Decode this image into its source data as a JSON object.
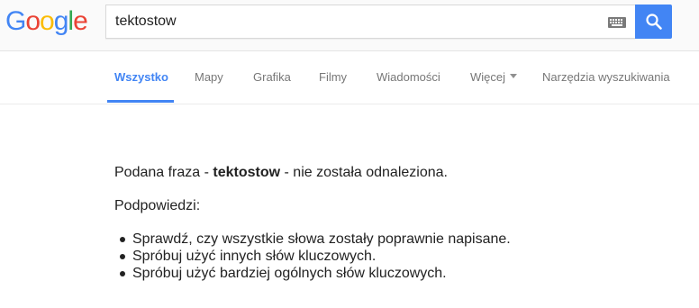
{
  "logo": {
    "letters": [
      {
        "char": "G",
        "color": "#4285f4"
      },
      {
        "char": "o",
        "color": "#ea4335"
      },
      {
        "char": "o",
        "color": "#fbbc05"
      },
      {
        "char": "g",
        "color": "#4285f4"
      },
      {
        "char": "l",
        "color": "#34a853"
      },
      {
        "char": "e",
        "color": "#ea4335"
      }
    ]
  },
  "search": {
    "query": "tektostow",
    "keyboard_icon": "keyboard-icon",
    "button_icon": "search-icon",
    "button_color": "#4285f4"
  },
  "tabs": [
    {
      "label": "Wszystko",
      "active": true
    },
    {
      "label": "Mapy",
      "active": false
    },
    {
      "label": "Grafika",
      "active": false
    },
    {
      "label": "Filmy",
      "active": false
    },
    {
      "label": "Wiadomości",
      "active": false
    },
    {
      "label": "Więcej",
      "active": false,
      "dropdown": true
    },
    {
      "label": "Narzędzia wyszukiwania",
      "active": false
    }
  ],
  "results": {
    "no_results_prefix": "Podana fraza - ",
    "no_results_query": "tektostow",
    "no_results_suffix": " - nie została odnaleziona.",
    "suggestions_heading": "Podpowiedzi:",
    "suggestions": [
      "Sprawdź, czy wszystkie słowa zostały poprawnie napisane.",
      "Spróbuj użyć innych słów kluczowych.",
      "Spróbuj użyć bardziej ogólnych słów kluczowych."
    ]
  },
  "colors": {
    "accent": "#4285f4",
    "tab_inactive": "#777777",
    "text": "#222222"
  }
}
